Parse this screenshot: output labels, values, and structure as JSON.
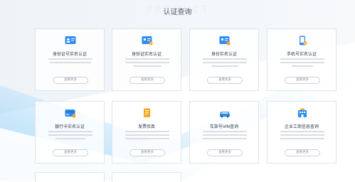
{
  "section": {
    "title": "认证查询"
  },
  "cards": [
    {
      "title": "身份证号实名认证",
      "more": "查看更多",
      "icon": "id-card-user-icon"
    },
    {
      "title": "身份证实名认证",
      "more": "查看更多",
      "icon": "id-card-check-icon"
    },
    {
      "title": "身份实名认证",
      "more": "查看更多",
      "icon": "id-card-badge-icon"
    },
    {
      "title": "手机号实名认证",
      "more": "查看更多",
      "icon": "phone-check-icon"
    },
    {
      "title": "银行卡实名认证",
      "more": "查看更多",
      "icon": "bank-card-icon"
    },
    {
      "title": "发票验真",
      "more": "查看更多",
      "icon": "invoice-icon"
    },
    {
      "title": "车架号VIN查询",
      "more": "查看更多",
      "icon": "car-icon"
    },
    {
      "title": "企业工商信息查询",
      "more": "查看更多",
      "icon": "enterprise-icon"
    }
  ],
  "colors": {
    "accent": "#2d8cf0",
    "badge": "#f5a623",
    "gradient_start": "#6ec3f4"
  }
}
